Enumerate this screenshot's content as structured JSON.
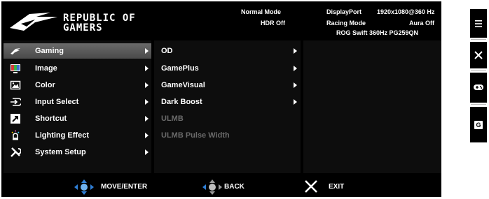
{
  "header": {
    "brand_line1": "REPUBLIC OF",
    "brand_line2": "GAMERS",
    "mode": "Normal Mode",
    "hdr": "HDR Off",
    "input": "DisplayPort",
    "racing": "Racing Mode",
    "resolution": "1920x1080@360 Hz",
    "aura": "Aura Off",
    "model": "ROG Swift 360Hz PG259QN"
  },
  "main_menu": [
    {
      "label": "Gaming",
      "icon": "rog-eye-icon",
      "selected": true
    },
    {
      "label": "Image",
      "icon": "image-icon"
    },
    {
      "label": "Color",
      "icon": "picture-icon"
    },
    {
      "label": "Input Select",
      "icon": "input-select-icon"
    },
    {
      "label": "Shortcut",
      "icon": "shortcut-icon"
    },
    {
      "label": "Lighting Effect",
      "icon": "lighting-icon"
    },
    {
      "label": "System Setup",
      "icon": "tools-icon"
    }
  ],
  "sub_menu": [
    {
      "label": "OD",
      "has_arrow": true,
      "disabled": false
    },
    {
      "label": "GamePlus",
      "has_arrow": true,
      "disabled": false
    },
    {
      "label": "GameVisual",
      "has_arrow": true,
      "disabled": false
    },
    {
      "label": "Dark Boost",
      "has_arrow": true,
      "disabled": false
    },
    {
      "label": "ULMB",
      "has_arrow": false,
      "disabled": true
    },
    {
      "label": "ULMB Pulse Width",
      "has_arrow": false,
      "disabled": true
    }
  ],
  "footer": {
    "move_enter": "MOVE/ENTER",
    "back": "BACK",
    "exit": "EXIT"
  },
  "side_buttons": [
    {
      "icon": "menu-icon"
    },
    {
      "icon": "close-icon"
    },
    {
      "icon": "gamepad-icon"
    },
    {
      "icon": "gameplus-icon",
      "label": "G"
    }
  ],
  "colors": {
    "background": "#000000",
    "selected": "#5a5a5a",
    "text": "#ffffff",
    "disabled": "#6a6a6a",
    "nav_blue": "#2f7fd6"
  }
}
